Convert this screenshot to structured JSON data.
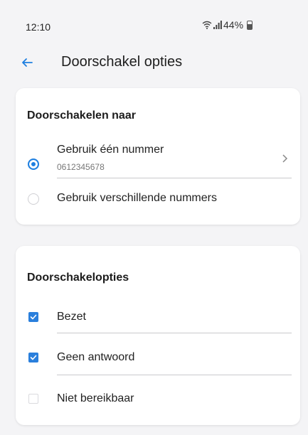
{
  "status_bar": {
    "time": "12:10",
    "battery": "44%",
    "icons": [
      "wifi-icon",
      "signal-icon",
      "battery-icon"
    ]
  },
  "app_bar": {
    "title": "Doorschakel opties",
    "back_icon": "arrow-left-icon"
  },
  "forward_to": {
    "heading": "Doorschakelen naar",
    "options": [
      {
        "label": "Gebruik één nummer",
        "value": "0612345678",
        "selected": true
      },
      {
        "label": "Gebruik verschillende nummers",
        "selected": false
      }
    ]
  },
  "forward_options": {
    "heading": "Doorschakelopties",
    "items": [
      {
        "label": "Bezet",
        "checked": true
      },
      {
        "label": "Geen antwoord",
        "checked": true
      },
      {
        "label": "Niet bereikbaar",
        "checked": false
      }
    ]
  },
  "colors": {
    "accent": "#1e7fe0",
    "background": "#f4f4f6",
    "card": "#ffffff"
  }
}
